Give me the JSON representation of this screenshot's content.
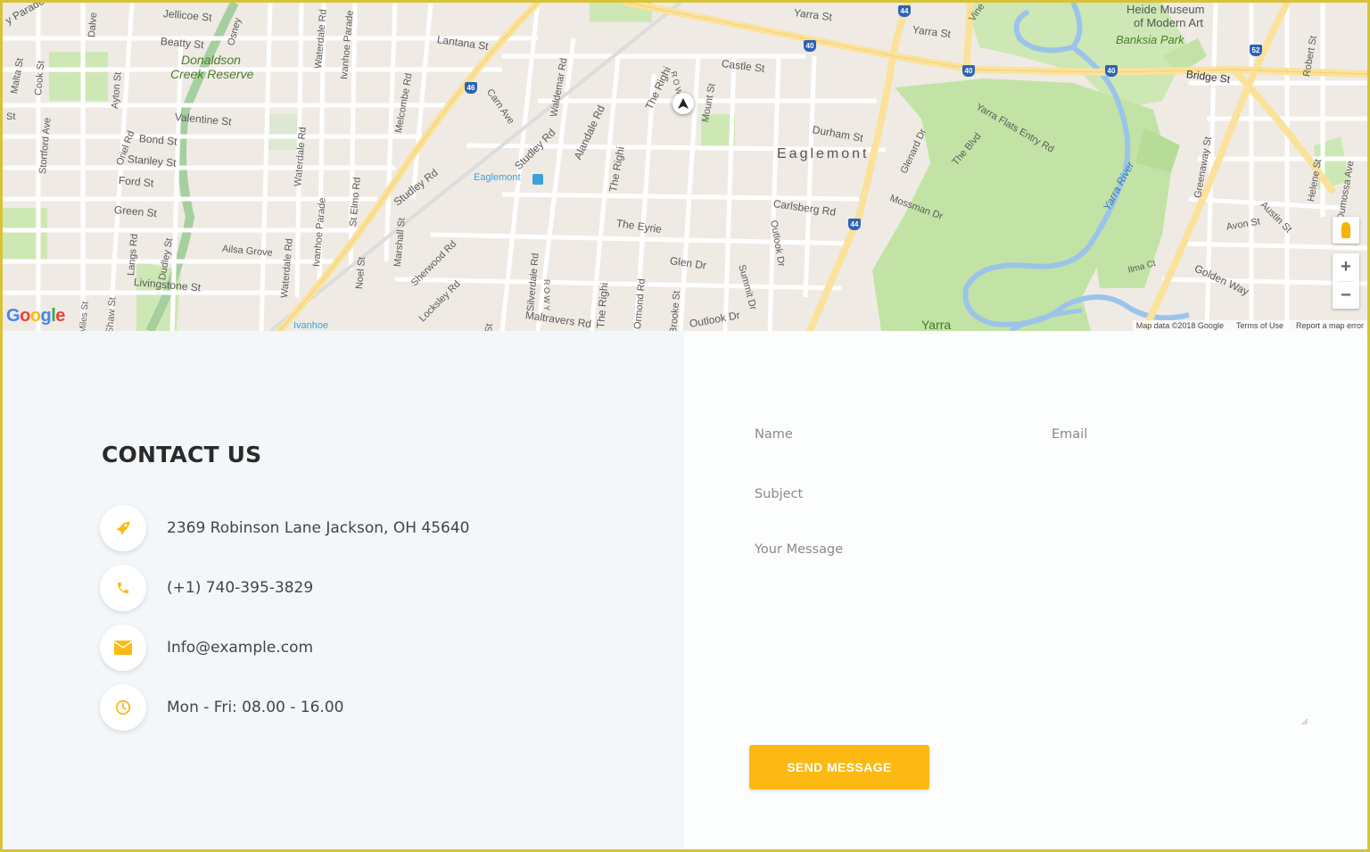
{
  "map": {
    "labels": {
      "parade": "y Parade",
      "jellicoe": "Jellicoe St",
      "beatty": "Beatty St",
      "donaldson": "Donaldson",
      "creek_reserve": "Creek Reserve",
      "valentine": "Valentine St",
      "bond": "Bond St",
      "stanley": "Stanley St",
      "ford": "Ford St",
      "green": "Green St",
      "ailsa": "Ailsa Grove",
      "livingstone": "Livingstone St",
      "lantana": "Lantana St",
      "castle": "Castle St",
      "yarra_st": "Yarra St",
      "yarra_st2": "Yarra St",
      "durham": "Durham St",
      "eaglemont": "Eaglemont",
      "eaglemont_station": "Eaglemont",
      "carlsberg": "Carlsberg Rd",
      "the_eyrie": "The Eyrie",
      "glen_dr": "Glen Dr",
      "outlook_dr": "Outlook Dr",
      "maltravers": "Maltravers Rd",
      "heide1": "Heide Museum",
      "heide2": "of Modern Art",
      "banksia_park": "Banksia Park",
      "bridge": "Bridge St",
      "yarra_river": "Yarra River",
      "yarra_flats": "Yarra Flats Entry Rd",
      "the_blvd": "The Blvd",
      "mossman": "Mossman Dr",
      "glenard": "Glenard Dr",
      "greenaway": "Greenaway St",
      "avon": "Avon St",
      "golden_way": "Golden Way",
      "ilma": "Ilma Ct",
      "austin": "Austin St",
      "helene": "Helene St",
      "dumossa": "Dumossa Ave",
      "robert": "Robert St",
      "yarra_bottom": "Yarra",
      "studley1": "Studley Rd",
      "studley2": "Studley Rd",
      "alandale": "Alandale Rd",
      "the_righi1": "The Righi",
      "the_righi2": "The Righi",
      "the_righi3": "The Righi",
      "mount": "Mount St",
      "rowy": "R O W Y",
      "rowy2": "R O W Y",
      "carn": "Carn Ave",
      "waldemar": "Waldemar Rd",
      "melcombe": "Melcombe Rd",
      "ivanhoe_parade": "Ivanhoe Parade",
      "ivanhoe_parade2": "Ivanhoe Parade",
      "waterdale1": "Waterdale Rd",
      "waterdale2": "Waterdale Rd",
      "waterdale3": "Waterdale Rd",
      "st_elmo": "St Elmo Rd",
      "marshall": "Marshall St",
      "sherwood": "Sherwood Rd",
      "locksley": "Locksley Rd",
      "noel": "Noel St",
      "silverdale": "Silverdale Rd",
      "ormond": "Ormond Rd",
      "brooke": "Brooke St",
      "summit": "Summit Dr",
      "malta": "Malta St",
      "cook": "Cook St",
      "stortford": "Stortford Ave",
      "ayton": "Ayton St",
      "oriel": "Oriel Rd",
      "langs": "Langs Rd",
      "dudley": "Dudley St",
      "miles": "Miles St",
      "shaw": "Shaw St",
      "ivanhoe_station": "Ivanhoe",
      "osney": "Osney",
      "dalve": "Dalve",
      "st_left": "St",
      "st_mid": "St",
      "vine": "Vine"
    },
    "shields": [
      "44",
      "40",
      "46",
      "40",
      "40",
      "52",
      "44",
      "44"
    ],
    "google_logo": [
      "G",
      "o",
      "o",
      "g",
      "l",
      "e"
    ],
    "attribution": {
      "data": "Map data ©2018 Google",
      "terms": "Terms of Use",
      "report": "Report a map error"
    },
    "zoom_in": "+",
    "zoom_out": "−"
  },
  "contact": {
    "title": "CONTACT US",
    "address": "2369 Robinson Lane Jackson, OH 45640",
    "phone": "(+1) 740-395-3829",
    "email": "Info@example.com",
    "hours": "Mon - Fri: 08.00 - 16.00"
  },
  "form": {
    "name_placeholder": "Name",
    "email_placeholder": "Email",
    "subject_placeholder": "Subject",
    "message_placeholder": "Your Message",
    "send_label": "SEND MESSAGE"
  },
  "colors": {
    "accent": "#fdb913",
    "frame": "#d8c23a",
    "left_panel": "#f4f7fa",
    "right_panel": "#fcfdfd"
  }
}
